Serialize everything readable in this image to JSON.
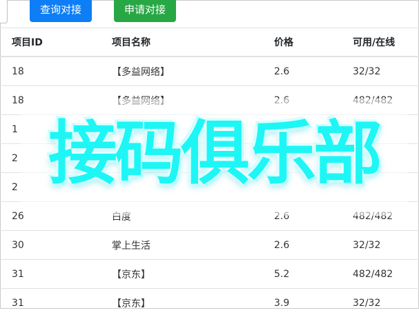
{
  "toolbar": {
    "query_label": "查询对接",
    "apply_label": "申请对接"
  },
  "table": {
    "headers": [
      "项目ID",
      "项目名称",
      "价格",
      "可用/在线"
    ],
    "rows": [
      [
        "18",
        "【多益网络】",
        "2.6",
        "32/32"
      ],
      [
        "18",
        "【多益网络】",
        "2.6",
        "482/482"
      ],
      [
        "1",
        "",
        "",
        ""
      ],
      [
        "2",
        "",
        "",
        ""
      ],
      [
        "2",
        "",
        "",
        ""
      ],
      [
        "26",
        "白度",
        "2.6",
        "482/482"
      ],
      [
        "30",
        "掌上生活",
        "2.6",
        "32/32"
      ],
      [
        "31",
        "【京东】",
        "5.2",
        "482/482"
      ],
      [
        "31",
        "【京东】",
        "3.9",
        "32/32"
      ]
    ]
  },
  "watermark": {
    "text": "接码俱乐部",
    "color": "#1ef6f6"
  }
}
